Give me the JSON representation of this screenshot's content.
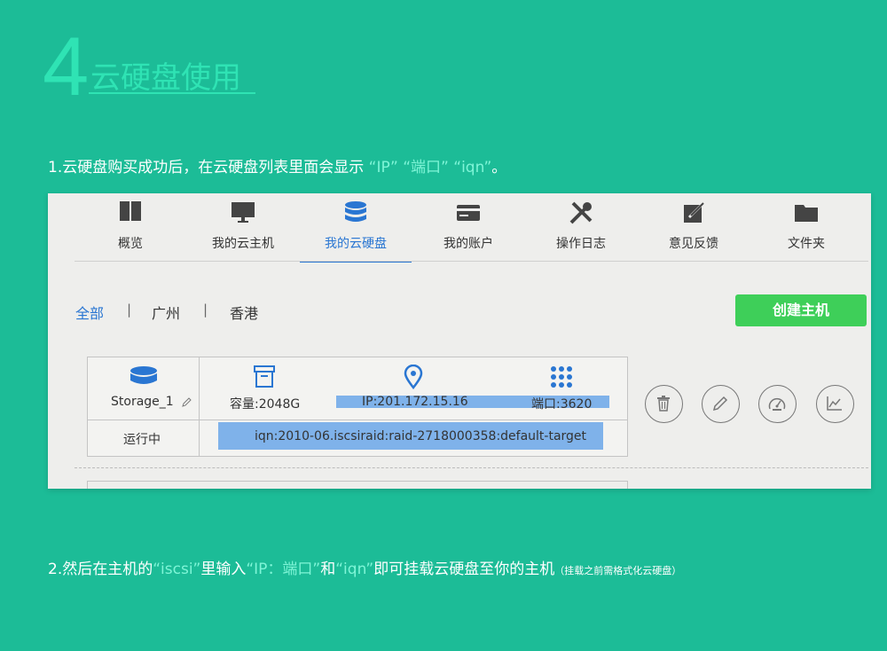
{
  "header": {
    "number": "4",
    "title": "云硬盘使用"
  },
  "step1": {
    "prefix": "1.云硬盘购买成功后，在云硬盘列表里面会显示",
    "q1": "“IP”",
    "q2": "“端口”",
    "q3": "“iqn”",
    "suffix": "。"
  },
  "step2": {
    "prefix": "2.然后在主机的",
    "q1": "“iscsi”",
    "mid1": "里输入",
    "q2": "“IP：端口”",
    "mid2": "和",
    "q3": "“iqn”",
    "mid3": "即可挂载云硬盘至你的主机",
    "note": "（挂载之前需格式化云硬盘）"
  },
  "nav": {
    "tabs": [
      {
        "label": "概览",
        "icon": "book-icon"
      },
      {
        "label": "我的云主机",
        "icon": "monitor-icon"
      },
      {
        "label": "我的云硬盘",
        "icon": "database-icon",
        "active": true
      },
      {
        "label": "我的账户",
        "icon": "credit-card-icon"
      },
      {
        "label": "操作日志",
        "icon": "tools-icon"
      },
      {
        "label": "意见反馈",
        "icon": "edit-icon"
      },
      {
        "label": "文件夹",
        "icon": "folder-icon"
      }
    ]
  },
  "filters": {
    "all": "全部",
    "sep": "|",
    "guangzhou": "广州",
    "hongkong": "香港"
  },
  "create_button": "创建主机",
  "disk": {
    "name": "Storage_1",
    "status": "运行中",
    "capacity": "容量:2048G",
    "ip": "IP:201.172.15.16",
    "port": "端口:3620",
    "iqn": "iqn:2010-06.iscsiraid:raid-2718000358:default-target"
  },
  "actions": [
    "trash-icon",
    "pencil-icon",
    "speedometer-icon",
    "chart-icon"
  ],
  "colors": {
    "background": "#1cbc97",
    "accent": "#2fe3b4",
    "highlight": "#7ff5d7",
    "active_tab": "#2a76d2",
    "button": "#3ecf59",
    "selection": "#7fb2ea"
  }
}
